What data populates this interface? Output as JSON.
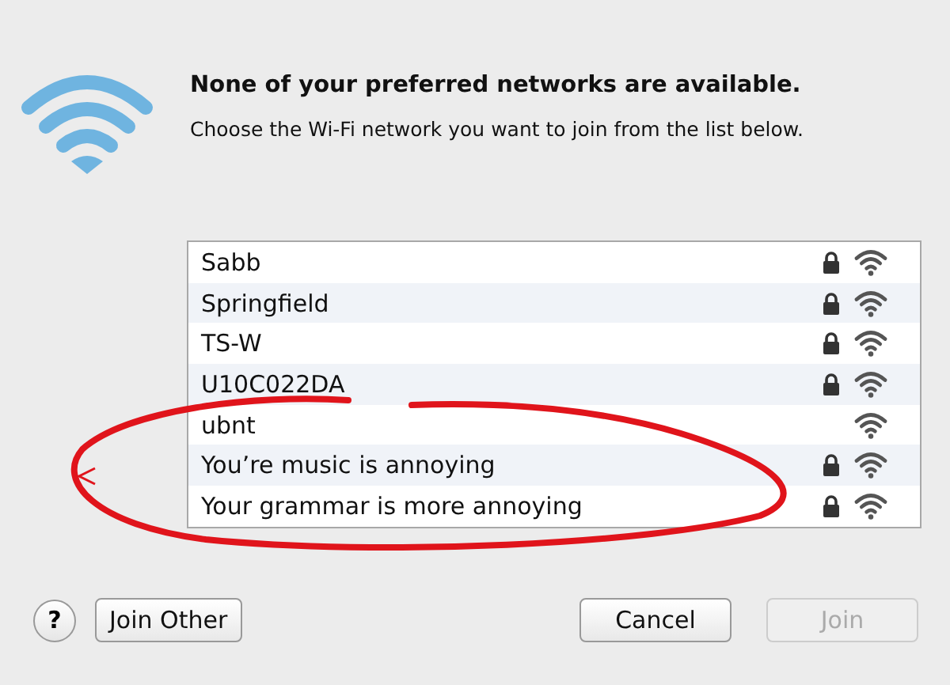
{
  "heading": "None of your preferred networks are available.",
  "subheading": "Choose the Wi-Fi network you want to join from the list below.",
  "networks": [
    {
      "name": "Sabb",
      "secured": true
    },
    {
      "name": "Springfield",
      "secured": true
    },
    {
      "name": "TS-W",
      "secured": true
    },
    {
      "name": "U10C022DA",
      "secured": true
    },
    {
      "name": "ubnt",
      "secured": false
    },
    {
      "name": "You’re music is annoying",
      "secured": true
    },
    {
      "name": "Your grammar is more annoying",
      "secured": true
    }
  ],
  "help": "?",
  "join_other": "Join Other",
  "buttons": [
    {
      "label": "Cancel",
      "disabled": false
    },
    {
      "label": "Join",
      "disabled": true
    }
  ]
}
